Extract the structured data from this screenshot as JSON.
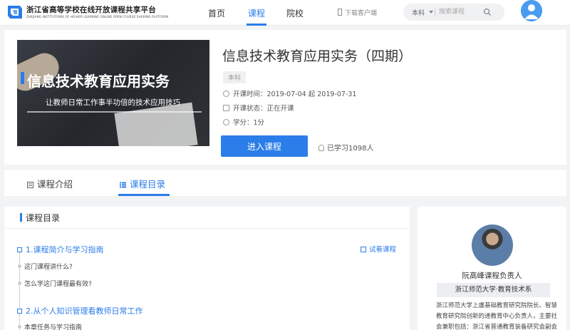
{
  "header": {
    "site_title": "浙江省高等学校在线开放课程共享平台",
    "site_subtitle": "ZHEJIANG INSTITUTIONS OF HIGHER LEARNING ONLINE OPEN COURSE SHARING PLATFORM",
    "nav": [
      {
        "label": "首页",
        "active": false
      },
      {
        "label": "课程",
        "active": true
      },
      {
        "label": "院校",
        "active": false
      }
    ],
    "download_label": "下载客户端",
    "search": {
      "scope": "本科",
      "placeholder": "搜索课程"
    },
    "accent_color": "#2b7de9"
  },
  "course": {
    "cover": {
      "title": "信息技术教育应用实务",
      "subtitle": "让教师日常工作事半功倍的技术应用技巧"
    },
    "title": "信息技术教育应用实务（四期）",
    "level": "本科",
    "start_time_label": "开课时间：",
    "start_time_value": "2019-07-04 起 2019-07-31",
    "status_label": "开课状态：",
    "status_value": "正在开课",
    "credit_label": "学分：",
    "credit_value": "1分",
    "enter_button": "进入课程",
    "learners": "已学习1098人"
  },
  "tabs": [
    {
      "label": "课程介绍",
      "active": false
    },
    {
      "label": "课程目录",
      "active": true
    }
  ],
  "catalog": {
    "header": "课程目录",
    "trial_label": "试看课程",
    "chapters": [
      {
        "title": "1.课程简介与学习指南",
        "lessons": [
          "这门课程讲什么?",
          "怎么学这门课程最有效?"
        ]
      },
      {
        "title": "2.从个人知识管理看教师日常工作",
        "lessons": [
          "本章任务与学习指南"
        ]
      }
    ]
  },
  "teacher": {
    "name": "阮高峰课程负责人",
    "dept": "浙江师范大学·教育技术系",
    "bio_lines": [
      "浙江师范大学上虞基础教育研究院院长、智慧",
      "教育研究院创新的递教育中心负责人，主要社",
      "会兼职包括：浙江省普通教育装备研究会副会"
    ]
  }
}
